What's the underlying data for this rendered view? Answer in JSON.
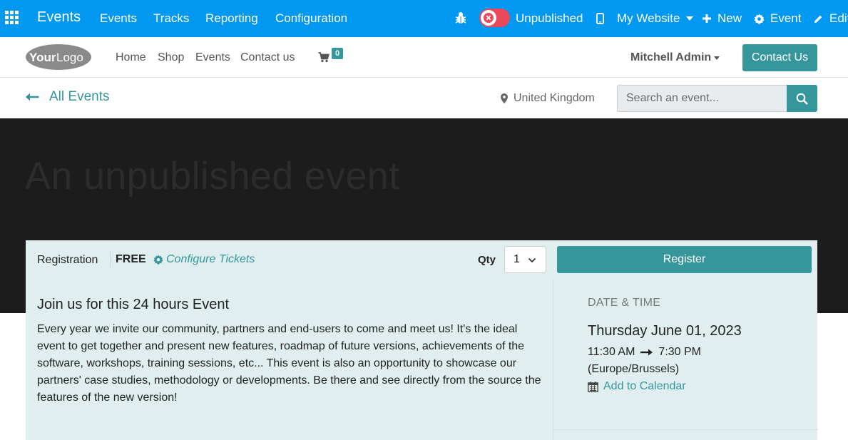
{
  "topbar": {
    "brand": "Events",
    "menu": [
      "Events",
      "Tracks",
      "Reporting",
      "Configuration"
    ],
    "publish_status": "Unpublished",
    "website": "My Website",
    "new_label": "New",
    "event_label": "Event",
    "edit_label": "Edit",
    "colors": {
      "bar": "#0098f0",
      "toggle_off": "#e8495b"
    }
  },
  "header": {
    "logo_text": "YourLogo",
    "nav": [
      "Home",
      "Shop",
      "Events",
      "Contact us"
    ],
    "cart_count": "0",
    "user": "Mitchell Admin",
    "contact_button": "Contact Us",
    "accent": "#35979c"
  },
  "events_bar": {
    "back_label": "All Events",
    "country": "United Kingdom",
    "search_placeholder": "Search an event..."
  },
  "hero": {
    "title": "An unpublished event"
  },
  "registration": {
    "label": "Registration",
    "price": "FREE",
    "configure_label": "Configure Tickets",
    "qty_label": "Qty",
    "qty_value": "1",
    "register_button": "Register"
  },
  "description": {
    "title": "Join us for this 24 hours Event",
    "body": "Every year we invite our community, partners and end-users to come and meet us! It's the ideal event to get together and present new features, roadmap of future versions, achievements of the software, workshops, training sessions, etc... This event is also an opportunity to showcase our partners' case studies, methodology or developments. Be there and see directly from the source the features of the new version!"
  },
  "schedule": {
    "heading": "DATE & TIME",
    "date": "Thursday June 01, 2023",
    "start_time": "11:30 AM",
    "end_time": "7:30 PM",
    "timezone": "(Europe/Brussels)",
    "add_calendar": "Add to Calendar"
  }
}
